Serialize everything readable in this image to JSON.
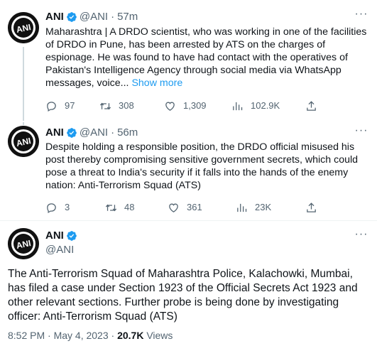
{
  "colors": {
    "accent": "#1d9bf0",
    "muted": "#536471",
    "text": "#0f1419",
    "verified": "#1d9bf0"
  },
  "tweets": [
    {
      "name": "ANI",
      "handle": "@ANI",
      "dot": "·",
      "time": "57m",
      "text": "Maharashtra | A DRDO scientist, who was working in one of the facilities of DRDO in Pune, has been arrested by ATS on the charges of espionage. He was found to have had contact with the operatives of Pakistan's Intelligence Agency through social media via WhatsApp messages, voice...",
      "show_more": "Show more",
      "replies": "97",
      "retweets": "308",
      "likes": "1,309",
      "views": "102.9K"
    },
    {
      "name": "ANI",
      "handle": "@ANI",
      "dot": "·",
      "time": "56m",
      "text": "Despite holding a responsible position, the DRDO official misused his post thereby compromising sensitive government secrets, which could pose a threat to India's security if it falls into the hands of the enemy nation: Anti-Terrorism Squad (ATS)",
      "replies": "3",
      "retweets": "48",
      "likes": "361",
      "views": "23K"
    }
  ],
  "main_tweet": {
    "name": "ANI",
    "handle": "@ANI",
    "text": "The Anti-Terrorism Squad of Maharashtra Police, Kalachowki, Mumbai, has filed a case under Section 1923 of the Official Secrets Act 1923 and other relevant sections. Further probe is being done by investigating officer: Anti-Terrorism Squad (ATS)",
    "time": "8:52 PM · May 4, 2023 · ",
    "views_count": "20.7K",
    "views_label": " Views"
  },
  "icons": {
    "avatar": "ani-logo-icon",
    "verified": "verified-badge-icon",
    "more": "more-options-icon",
    "reply": "reply-icon",
    "retweet": "retweet-icon",
    "like": "heart-icon",
    "views": "views-chart-icon",
    "share": "share-icon"
  }
}
